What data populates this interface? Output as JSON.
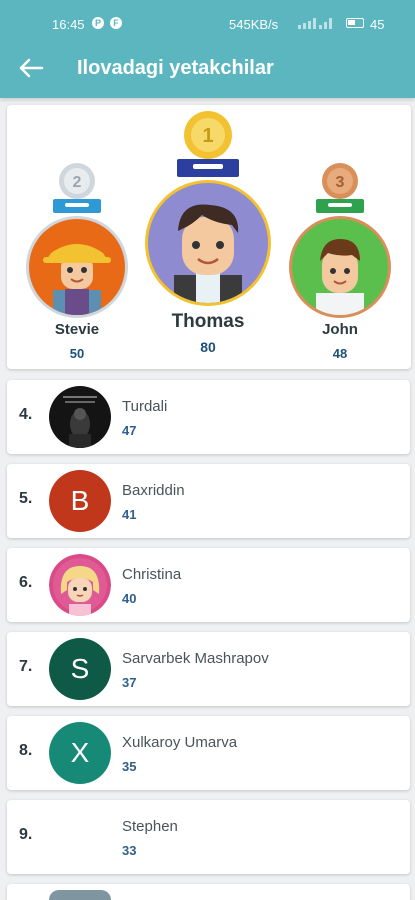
{
  "status_bar": {
    "time": "16:45",
    "icon1": "P",
    "icon2": "F",
    "network_speed": "545KB/s",
    "battery_percent": "45"
  },
  "header": {
    "title": "Ilovadagi yetakchilar",
    "back_icon": "arrow-left-icon"
  },
  "podium": {
    "first": {
      "medal": "1",
      "name": "Thomas",
      "score": "80"
    },
    "second": {
      "medal": "2",
      "name": "Stevie",
      "score": "50"
    },
    "third": {
      "medal": "3",
      "name": "John",
      "score": "48"
    }
  },
  "leaders": [
    {
      "rank": "4.",
      "name": "Turdali",
      "score": "47"
    },
    {
      "rank": "5.",
      "name": "Baxriddin",
      "score": "41",
      "initial": "B"
    },
    {
      "rank": "6.",
      "name": "Christina",
      "score": "40"
    },
    {
      "rank": "7.",
      "name": "Sarvarbek Mashrapov",
      "score": "37",
      "initial": "S"
    },
    {
      "rank": "8.",
      "name": "Xulkaroy Umarva",
      "score": "35",
      "initial": "X"
    },
    {
      "rank": "9.",
      "name": "Stephen",
      "score": "33"
    }
  ],
  "colors": {
    "app_bar": "#5cb6c0",
    "gold": "#f2c230",
    "silver": "#cfd6dc",
    "bronze": "#d98f5a",
    "avatar_b": "#c0371b",
    "avatar_s": "#0f5a46",
    "avatar_x": "#168a77"
  }
}
